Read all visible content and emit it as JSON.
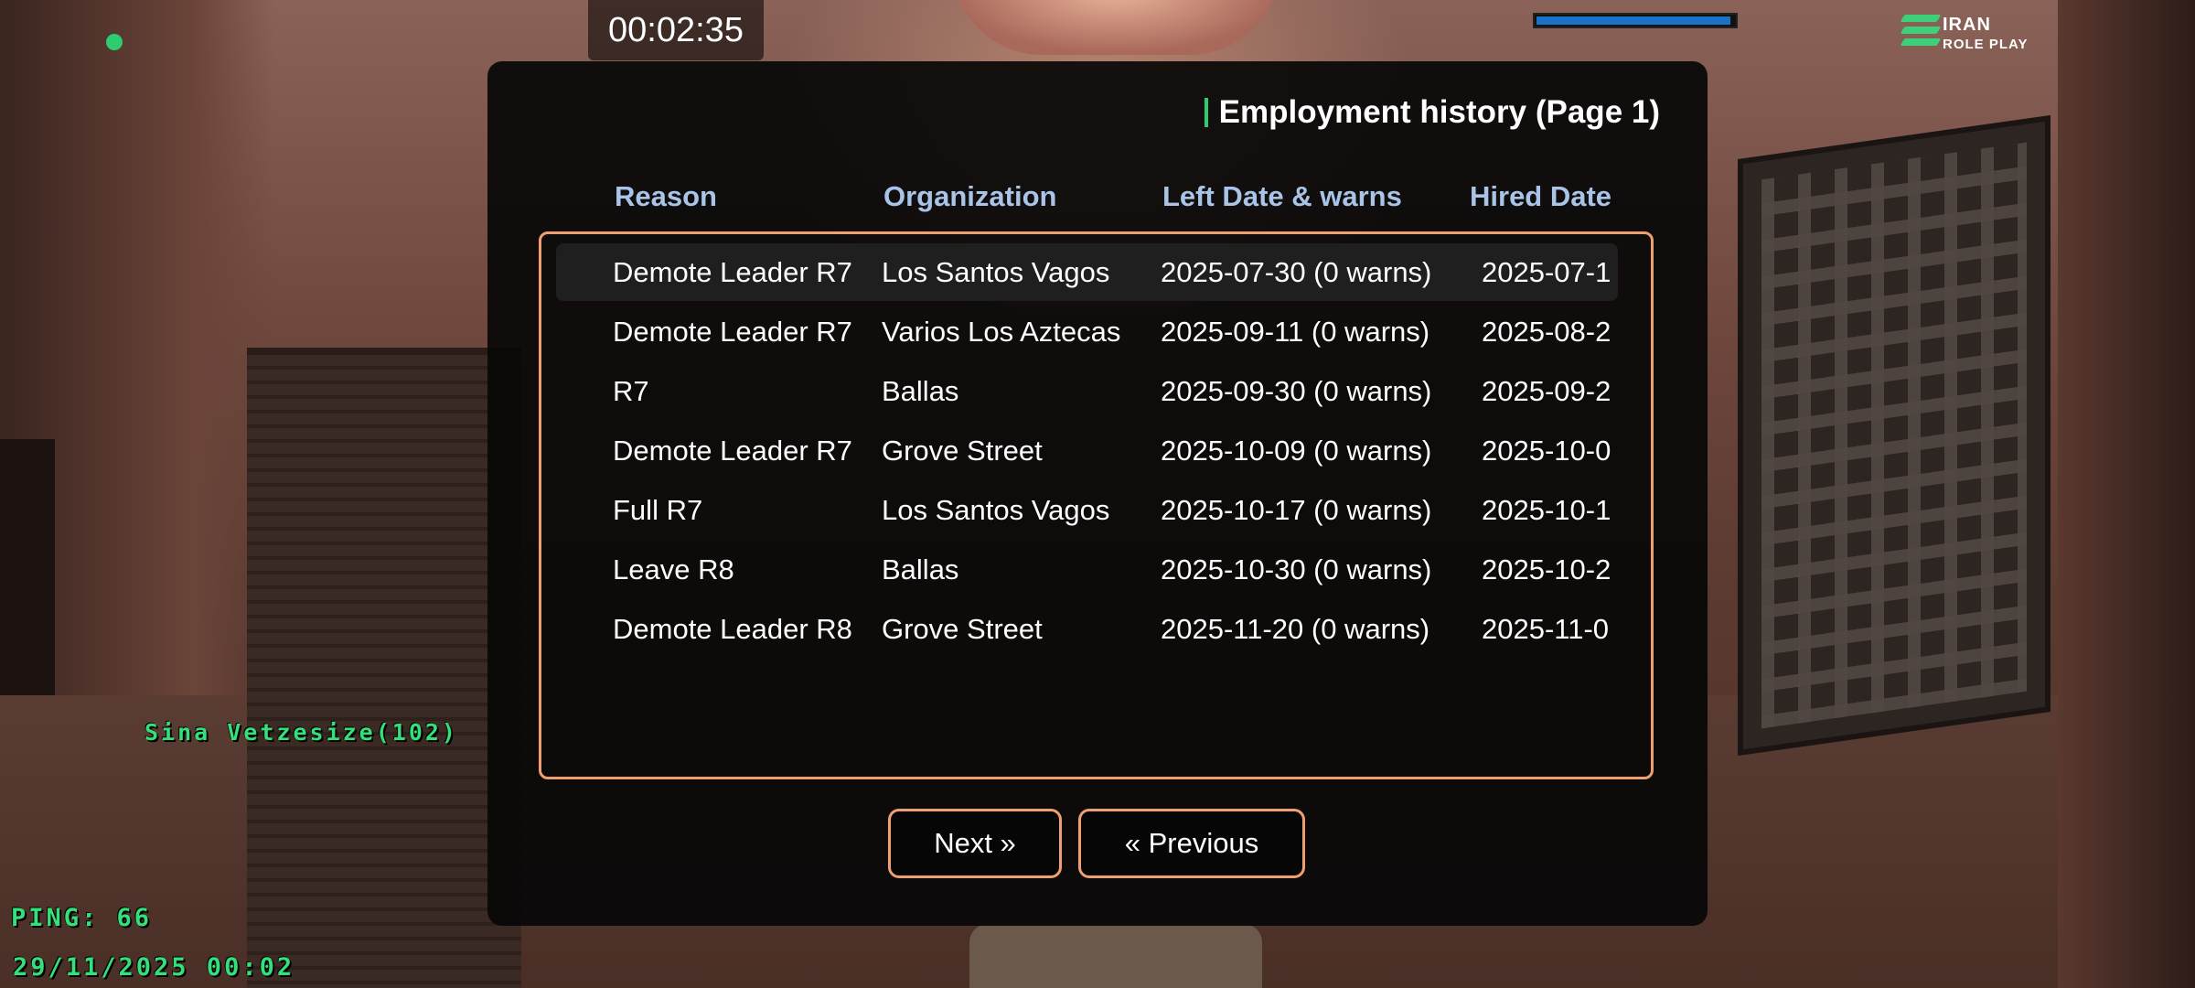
{
  "hud": {
    "timer": "00:02:35",
    "bar_level": 0.98,
    "bar_color": "#1a73c9",
    "logo_line1": "IRAN",
    "logo_line2": "ROLE PLAY",
    "player_name": "Sina Vetzesize(102)",
    "ping": "PING: 66",
    "datetime": "29/11/2025 00:02",
    "status_color": "#2ecc71",
    "hud_text_color": "#33e07a"
  },
  "dialog": {
    "title": "Employment history (Page 1)",
    "columns": [
      "Reason",
      "Organization",
      "Left Date & warns",
      "Hired Date"
    ],
    "rows": [
      {
        "reason": "Demote Leader R7",
        "organization": "Los Santos Vagos",
        "left": "2025-07-30 (0 warns)",
        "hired": "2025-07-1"
      },
      {
        "reason": "Demote Leader R7",
        "organization": "Varios Los Aztecas",
        "left": "2025-09-11 (0 warns)",
        "hired": "2025-08-2"
      },
      {
        "reason": "R7",
        "organization": "Ballas",
        "left": "2025-09-30 (0 warns)",
        "hired": "2025-09-2"
      },
      {
        "reason": "Demote Leader R7",
        "organization": "Grove Street",
        "left": "2025-10-09 (0 warns)",
        "hired": "2025-10-0"
      },
      {
        "reason": "Full R7",
        "organization": "Los Santos Vagos",
        "left": "2025-10-17 (0 warns)",
        "hired": "2025-10-1"
      },
      {
        "reason": "Leave R8",
        "organization": "Ballas",
        "left": "2025-10-30 (0 warns)",
        "hired": "2025-10-2"
      },
      {
        "reason": "Demote Leader R8",
        "organization": "Grove Street",
        "left": "2025-11-20 (0 warns)",
        "hired": "2025-11-0"
      }
    ],
    "next_label": "Next »",
    "prev_label": "« Previous",
    "accent_color": "#f0a070",
    "header_color": "#a8c4e8"
  }
}
